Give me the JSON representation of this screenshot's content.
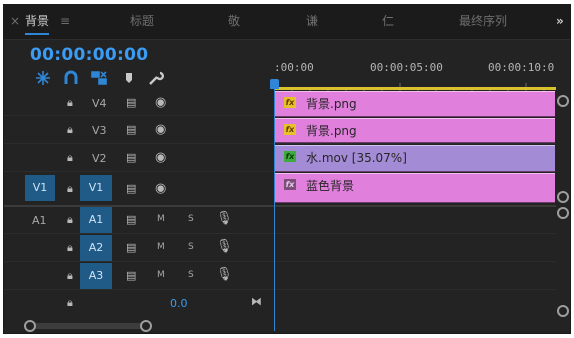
{
  "tabs": [
    {
      "label": "×",
      "x_offset": 0
    },
    {
      "label": "背景",
      "active": true
    },
    {
      "label": "≡"
    },
    {
      "label": "标题"
    },
    {
      "label": "敬"
    },
    {
      "label": "谦"
    },
    {
      "label": "仁"
    },
    {
      "label": "最终序列"
    },
    {
      "label": "»"
    }
  ],
  "timecode": "00:00:00:00",
  "toolbar": {
    "snap": "snap-icon",
    "linked": "magnet-icon",
    "insert": "insert-icon",
    "marker": "marker-icon",
    "settings": "wrench-icon"
  },
  "ruler": {
    "labels": [
      ":00:00",
      "00:00:05:00",
      "00:00:10:0"
    ]
  },
  "tracks": {
    "video": [
      {
        "name": "V4",
        "source": ""
      },
      {
        "name": "V3",
        "source": ""
      },
      {
        "name": "V2",
        "source": ""
      },
      {
        "name": "V1",
        "source": "V1"
      }
    ],
    "audio": [
      {
        "name": "A1",
        "source": "A1",
        "m": "M",
        "s": "S"
      },
      {
        "name": "A2",
        "source": "",
        "m": "M",
        "s": "S"
      },
      {
        "name": "A3",
        "source": "",
        "m": "M",
        "s": "S"
      }
    ],
    "master_value": "0.0"
  },
  "clips": [
    {
      "name": "背景.png",
      "badge_color": "#e6c22a"
    },
    {
      "name": "背景.png",
      "badge_color": "#e6c22a"
    },
    {
      "name": "水.mov [35.07%]",
      "badge_color": "#3dac3d"
    },
    {
      "name": "蓝色背景",
      "badge_color": "#7a4f7a"
    }
  ],
  "colors": {
    "accent": "#2f86d6",
    "clip": "#e07fdc",
    "clip_selected": "#a48bd6"
  }
}
